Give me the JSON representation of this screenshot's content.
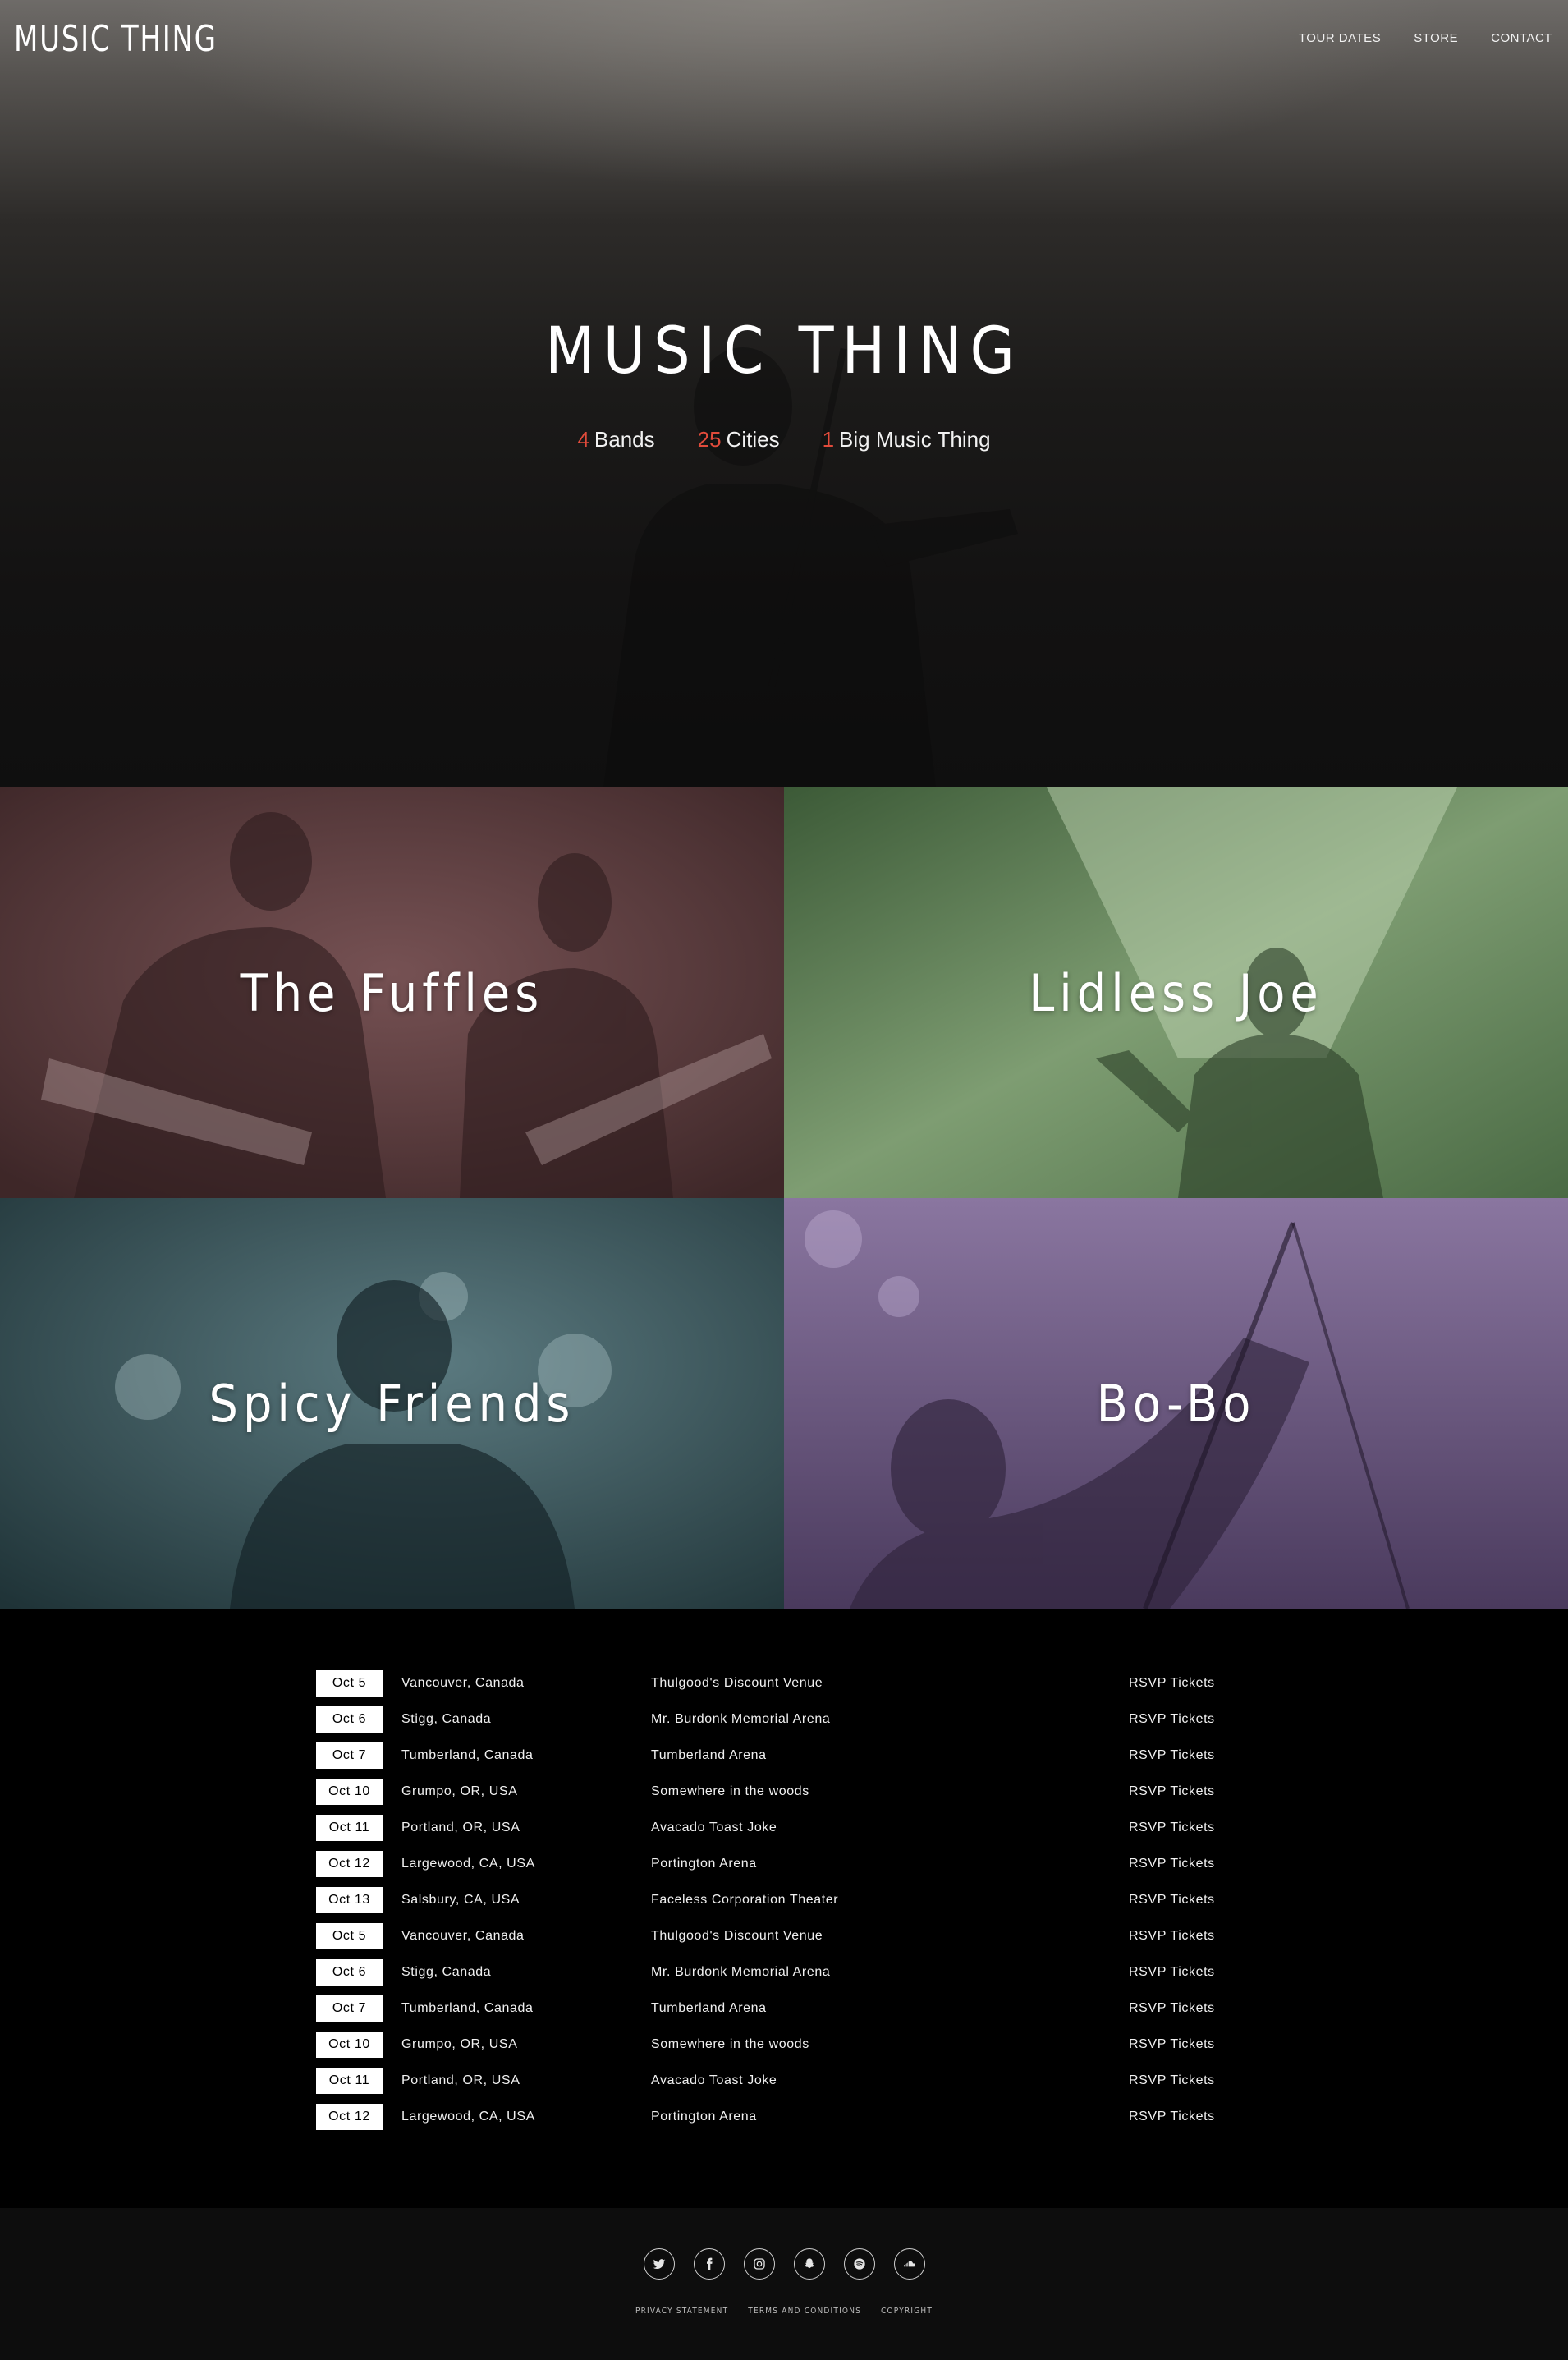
{
  "header": {
    "logo": "MUSIC THING",
    "nav": [
      {
        "label": "TOUR DATES"
      },
      {
        "label": "STORE"
      },
      {
        "label": "CONTACT"
      }
    ]
  },
  "hero": {
    "title": "MUSIC THING",
    "stats": [
      {
        "number": "4",
        "label": "Bands"
      },
      {
        "number": "25",
        "label": "Cities"
      },
      {
        "number": "1",
        "label": "Big Music Thing"
      }
    ],
    "accent_color": "#e14b3b"
  },
  "bands": [
    {
      "name": "The Fuffles",
      "tint": "#5a3a3c"
    },
    {
      "name": "Lidless Joe",
      "tint": "#5b7a52"
    },
    {
      "name": "Spicy Friends",
      "tint": "#2f4a4f"
    },
    {
      "name": "Bo-Bo",
      "tint": "#6c5880"
    }
  ],
  "tour": {
    "rows": [
      {
        "date": "Oct 5",
        "city": "Vancouver, Canada",
        "venue": "Thulgood's Discount Venue",
        "rsvp": "RSVP Tickets"
      },
      {
        "date": "Oct 6",
        "city": "Stigg, Canada",
        "venue": "Mr. Burdonk Memorial Arena",
        "rsvp": "RSVP Tickets"
      },
      {
        "date": "Oct 7",
        "city": "Tumberland, Canada",
        "venue": "Tumberland Arena",
        "rsvp": "RSVP Tickets"
      },
      {
        "date": "Oct 10",
        "city": "Grumpo, OR, USA",
        "venue": "Somewhere in the woods",
        "rsvp": "RSVP Tickets"
      },
      {
        "date": "Oct 11",
        "city": "Portland, OR, USA",
        "venue": "Avacado Toast Joke",
        "rsvp": "RSVP Tickets"
      },
      {
        "date": "Oct 12",
        "city": "Largewood, CA, USA",
        "venue": "Portington Arena",
        "rsvp": "RSVP Tickets"
      },
      {
        "date": "Oct 13",
        "city": "Salsbury, CA, USA",
        "venue": "Faceless Corporation Theater",
        "rsvp": "RSVP Tickets"
      },
      {
        "date": "Oct 5",
        "city": "Vancouver, Canada",
        "venue": "Thulgood's Discount Venue",
        "rsvp": "RSVP Tickets"
      },
      {
        "date": "Oct 6",
        "city": "Stigg, Canada",
        "venue": "Mr. Burdonk Memorial Arena",
        "rsvp": "RSVP Tickets"
      },
      {
        "date": "Oct 7",
        "city": "Tumberland, Canada",
        "venue": "Tumberland Arena",
        "rsvp": "RSVP Tickets"
      },
      {
        "date": "Oct 10",
        "city": "Grumpo, OR, USA",
        "venue": "Somewhere in the woods",
        "rsvp": "RSVP Tickets"
      },
      {
        "date": "Oct 11",
        "city": "Portland, OR, USA",
        "venue": "Avacado Toast Joke",
        "rsvp": "RSVP Tickets"
      },
      {
        "date": "Oct 12",
        "city": "Largewood, CA, USA",
        "venue": "Portington Arena",
        "rsvp": "RSVP Tickets"
      }
    ]
  },
  "footer": {
    "socials": [
      {
        "icon": "twitter-icon"
      },
      {
        "icon": "facebook-icon"
      },
      {
        "icon": "instagram-icon"
      },
      {
        "icon": "snapchat-icon"
      },
      {
        "icon": "spotify-icon"
      },
      {
        "icon": "soundcloud-icon"
      }
    ],
    "links": [
      {
        "label": "PRIVACY STATEMENT"
      },
      {
        "label": "TERMS AND CONDITIONS"
      },
      {
        "label": "COPYRIGHT"
      }
    ]
  }
}
